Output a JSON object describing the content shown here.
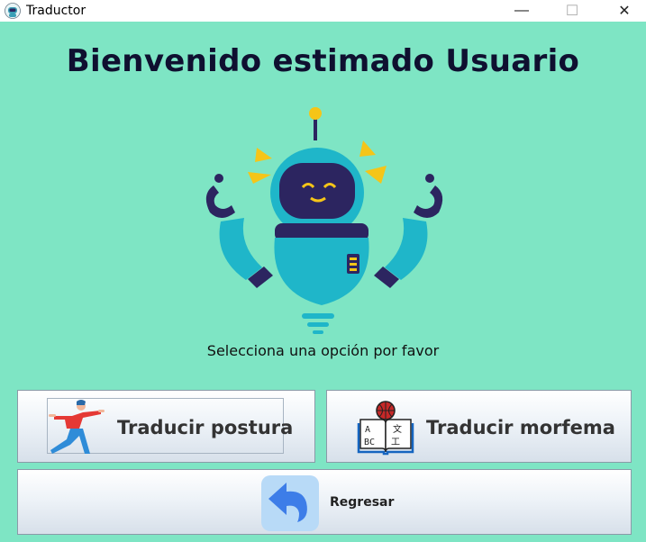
{
  "window": {
    "title": "Traductor",
    "icon": "robot-app-icon",
    "controls": {
      "minimize": "—",
      "maximize": "☐",
      "close": "✕"
    }
  },
  "main": {
    "heading": "Bienvenido estimado Usuario",
    "illustration": "meditating-robot",
    "subtitle": "Selecciona una opción por favor"
  },
  "buttons": {
    "postura": {
      "label": "Traducir postura",
      "icon": "person-pose-icon"
    },
    "morfema": {
      "label": "Traducir morfema",
      "icon": "language-book-icon"
    },
    "regresar": {
      "label": "Regresar",
      "icon": "back-arrow-icon"
    }
  },
  "colors": {
    "background": "#7ee5c4",
    "heading": "#0f1030",
    "robot_body": "#1fb6c9",
    "robot_dark": "#2c2560",
    "accent_yellow": "#f5c518"
  }
}
